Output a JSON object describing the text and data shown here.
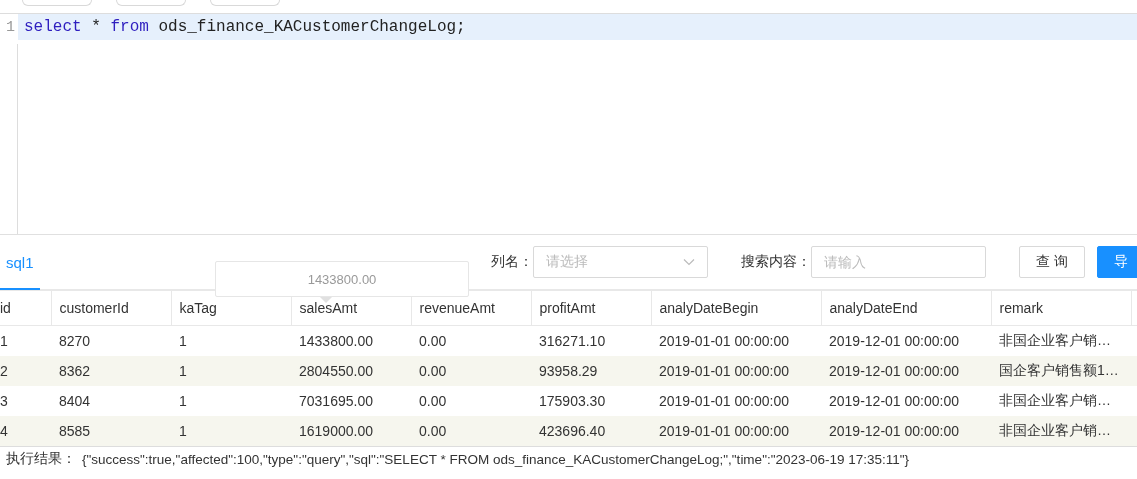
{
  "toolbar_buttons": [
    {
      "kind": "button"
    },
    {
      "kind": "button"
    },
    {
      "kind": "button"
    }
  ],
  "editor": {
    "lines": [
      {
        "number": "1",
        "active": true,
        "tokens": [
          {
            "kind": "keyword",
            "text": "select"
          },
          {
            "kind": "plain",
            "text": " * "
          },
          {
            "kind": "keyword",
            "text": "from"
          },
          {
            "kind": "plain",
            "text": " ods_finance_KACustomerChangeLog;"
          }
        ]
      }
    ]
  },
  "result_tabs": [
    {
      "label": "sql1",
      "selected": true
    }
  ],
  "filters": {
    "column_label": "列名：",
    "column_select": {
      "placeholder": "请选择"
    },
    "search_label": "搜索内容：",
    "search_field": {
      "placeholder": "请输入"
    },
    "buttons": [
      {
        "label": "查 询",
        "kind": "default"
      },
      {
        "label": "导",
        "kind": "primary"
      }
    ]
  },
  "tooltip": {
    "text": "1433800.00"
  },
  "table": {
    "columns": [
      "id",
      "customerId",
      "kaTag",
      "salesAmt",
      "revenueAmt",
      "profitAmt",
      "analyDateBegin",
      "analyDateEnd",
      "remark"
    ],
    "rows": [
      [
        "1",
        "8270",
        "1",
        "1433800.00",
        "0.00",
        "316271.10",
        "2019-01-01 00:00:00",
        "2019-12-01 00:00:00",
        "非国企业客户销…"
      ],
      [
        "2",
        "8362",
        "1",
        "2804550.00",
        "0.00",
        "93958.29",
        "2019-01-01 00:00:00",
        "2019-12-01 00:00:00",
        "国企客户销售额1…"
      ],
      [
        "3",
        "8404",
        "1",
        "7031695.00",
        "0.00",
        "175903.30",
        "2019-01-01 00:00:00",
        "2019-12-01 00:00:00",
        "非国企业客户销…"
      ],
      [
        "4",
        "8585",
        "1",
        "1619000.00",
        "0.00",
        "423696.40",
        "2019-01-01 00:00:00",
        "2019-12-01 00:00:00",
        "非国企业客户销…"
      ]
    ]
  },
  "status_bar": {
    "label": "执行结果：",
    "text": "{\"success\":true,\"affected\":100,\"type\":\"query\",\"sql\":\"SELECT * FROM ods_finance_KACustomerChangeLog;\",\"time\":\"2023-06-19 17:35:11\"}"
  }
}
